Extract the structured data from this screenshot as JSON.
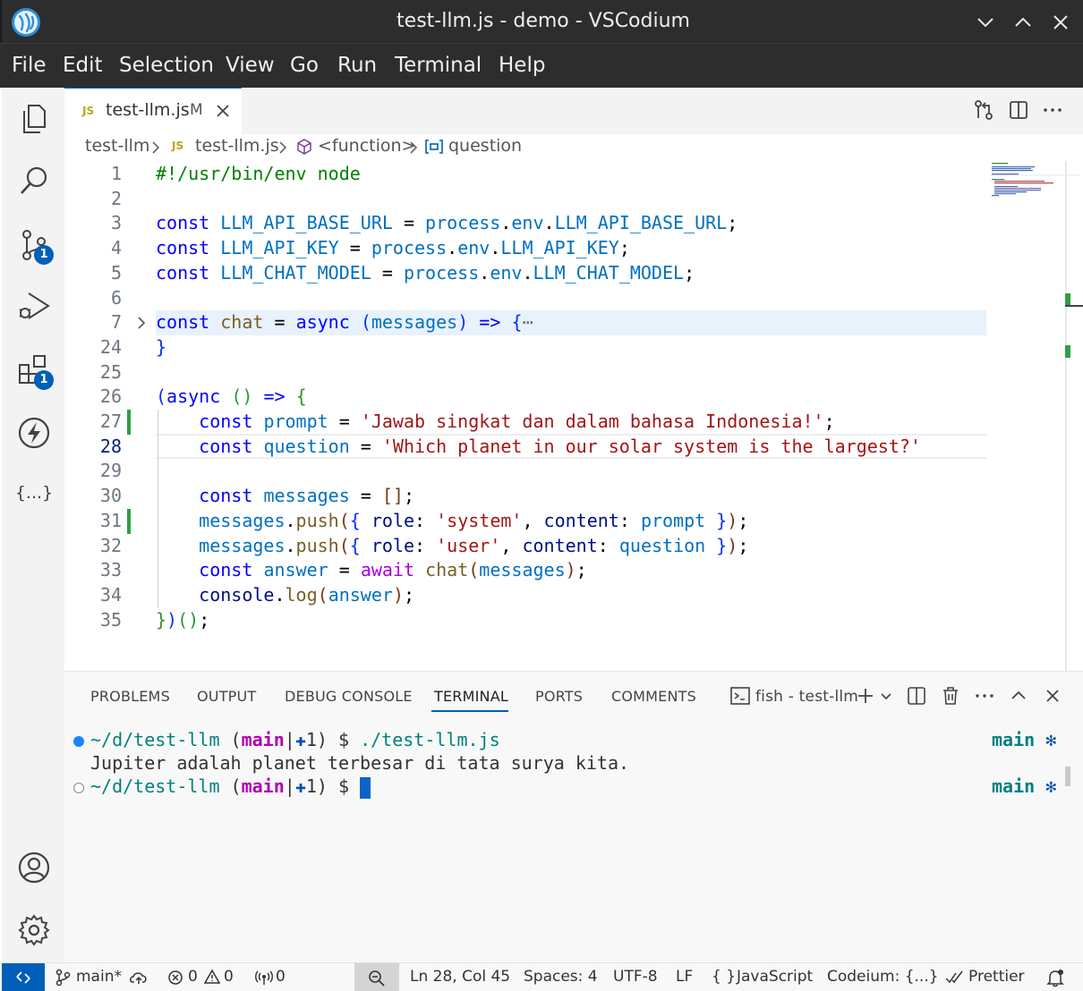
{
  "window": {
    "title": "test-llm.js - demo - VSCodium"
  },
  "menu": [
    "File",
    "Edit",
    "Selection",
    "View",
    "Go",
    "Run",
    "Terminal",
    "Help"
  ],
  "activity": {
    "scm_badge": "1",
    "ext_badge": "1",
    "json_icon": "{...}"
  },
  "tab": {
    "icon_text": "JS",
    "label": "test-llm.js",
    "modified": "M"
  },
  "breadcrumb": {
    "folder": "test-llm",
    "file_icon": "JS",
    "file": "test-llm.js",
    "func": "<function>",
    "symbol": "question"
  },
  "editor": {
    "line_numbers": [
      "1",
      "2",
      "3",
      "4",
      "5",
      "6",
      "7",
      "24",
      "25",
      "26",
      "27",
      "28",
      "29",
      "30",
      "31",
      "32",
      "33",
      "34",
      "35"
    ],
    "fold_ellipsis": "⋯"
  },
  "panel": {
    "tabs": [
      "PROBLEMS",
      "OUTPUT",
      "DEBUG CONSOLE",
      "TERMINAL",
      "PORTS",
      "COMMENTS"
    ],
    "terminal_name": "fish - test-llm",
    "lines": {
      "l1_path": "~/d/test-llm",
      "l1_open": " (",
      "l1_branch": "main",
      "l1_sep": "|",
      "l1_plus": "✚",
      "l1_count": "1",
      "l1_close": ") $ ",
      "l1_cmd": "./test-llm.js",
      "l2_output": "Jupiter adalah planet terbesar di tata surya kita.",
      "l3_path": "~/d/test-llm",
      "l3_close": ") $ ",
      "right_branch": "main",
      "right_mark": "✻"
    }
  },
  "status": {
    "branch": "main*",
    "errors": "0",
    "warnings": "0",
    "ports": "0",
    "position": "Ln 28, Col 45",
    "spaces": "Spaces: 4",
    "encoding": "UTF-8",
    "eol": "LF",
    "lang_icon": "{ }",
    "language": "JavaScript",
    "codeium": "Codeium: {...}",
    "prettier": "Prettier"
  }
}
